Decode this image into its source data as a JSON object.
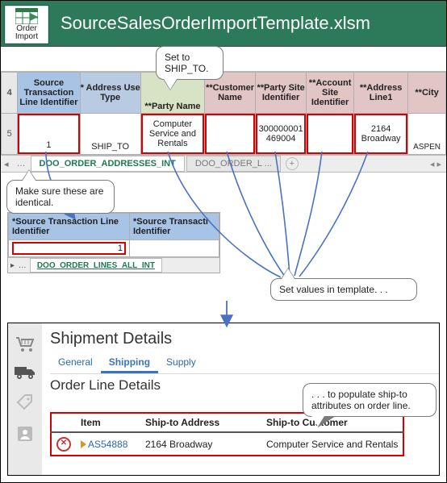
{
  "appbar": {
    "title": "SourceSalesOrderImportTemplate.xlsm",
    "tool_label_line1": "Order",
    "tool_label_line2": "Import"
  },
  "callouts": {
    "ship_to": "Set to SHIP_TO.",
    "identical": "Make sure these are identical.",
    "set_values": "Set values  in template. . .",
    "populate": ". . . to populate ship-to attributes on order line."
  },
  "sheet1": {
    "row_hdr_top": "4",
    "row_hdr_bottom": "5",
    "headers": {
      "c1": "Source Transaction Line Identifier",
      "c2": "* Address Use Type",
      "c3": "**Party Name",
      "c4": "**Customer Name",
      "c5": "**Party Site Identifier",
      "c6": "**Account Site Identifier",
      "c7": "**Address Line1",
      "c8": "**City"
    },
    "values": {
      "c1": "1",
      "c2": "SHIP_TO",
      "c3": "Computer Service and Rentals",
      "c4": "",
      "c5": "300000001469004",
      "c6": "",
      "c7": "2164 Broadway",
      "c8": "ASPEN"
    },
    "tabs": {
      "active": "DOO_ORDER_ADDRESSES_INT",
      "inactive": "DOO_ORDER_L ...",
      "nav_left": "◂",
      "nav_ell": "…",
      "plus": "+",
      "scroll": "◂                     ▸"
    }
  },
  "sheet2": {
    "headers": {
      "c1": "*Source Transaction Line Identifier",
      "c2": "*Source Transacti Identifier"
    },
    "values": {
      "c1": "1",
      "c2": ""
    },
    "tabs": {
      "nav": "▸  …",
      "active": "DOO_ORDER_LINES_ALL_INT"
    }
  },
  "panel": {
    "heading": "Shipment Details",
    "tabs": {
      "general": "General",
      "shipping": "Shipping",
      "supply": "Supply"
    },
    "subheading": "Order Line Details",
    "table": {
      "cols": {
        "item": "Item",
        "addr": "Ship-to Address",
        "cust": "Ship-to Customer"
      },
      "row": {
        "item": "AS54888",
        "addr": "2164 Broadway",
        "cust": "Computer Service and Rentals"
      }
    }
  }
}
